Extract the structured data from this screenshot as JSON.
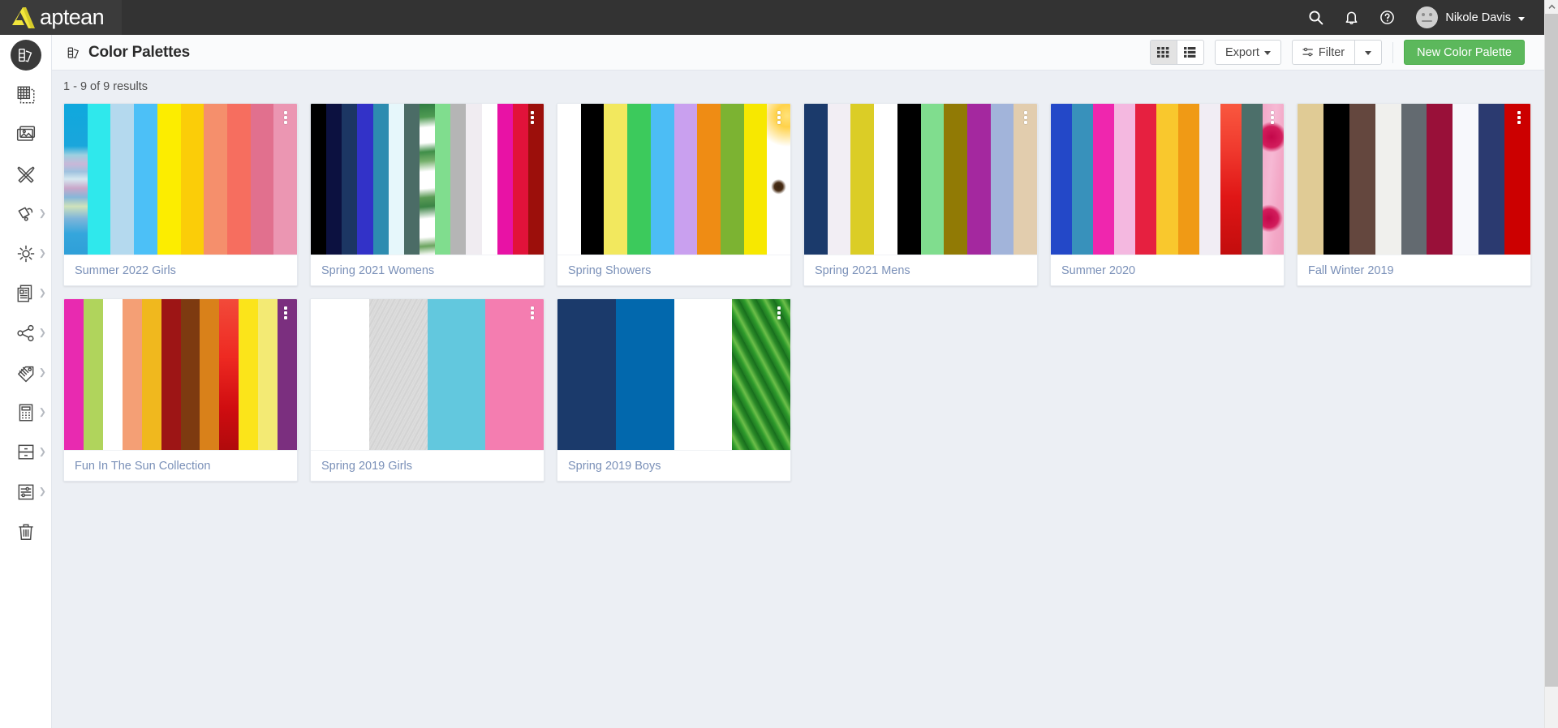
{
  "topbar": {
    "brand_name": "aptean",
    "brand_logo_icon": "aptean-triangle-logo",
    "icons": [
      {
        "name": "search-icon",
        "label": "Search"
      },
      {
        "name": "bell-icon",
        "label": "Notifications"
      },
      {
        "name": "help-icon",
        "label": "Help"
      }
    ],
    "user": {
      "name": "Nikole Davis",
      "avatar_icon": "user-avatar",
      "caret_icon": "chevron-down-icon"
    },
    "background_color": "#333333"
  },
  "sidebar": {
    "items": [
      {
        "name": "color-palettes",
        "icon": "color-palette-icon",
        "active": true,
        "has_arrow": false
      },
      {
        "name": "fabrics",
        "icon": "grid-sheets-icon",
        "active": false,
        "has_arrow": false
      },
      {
        "name": "images",
        "icon": "image-icon",
        "active": false,
        "has_arrow": false
      },
      {
        "name": "tools",
        "icon": "tools-cross-icon",
        "active": false,
        "has_arrow": false
      },
      {
        "name": "trims",
        "icon": "tag-pin-icon",
        "active": false,
        "has_arrow": true
      },
      {
        "name": "treatments",
        "icon": "sun-burst-icon",
        "active": false,
        "has_arrow": true
      },
      {
        "name": "documents",
        "icon": "documents-icon",
        "active": false,
        "has_arrow": true
      },
      {
        "name": "share",
        "icon": "share-nodes-icon",
        "active": false,
        "has_arrow": true
      },
      {
        "name": "labels",
        "icon": "label-tag-icon",
        "active": false,
        "has_arrow": true
      },
      {
        "name": "reports",
        "icon": "report-list-icon",
        "active": false,
        "has_arrow": true
      },
      {
        "name": "storage",
        "icon": "drawers-icon",
        "active": false,
        "has_arrow": true
      },
      {
        "name": "settings",
        "icon": "sliders-icon",
        "active": false,
        "has_arrow": true
      },
      {
        "name": "trash",
        "icon": "trash-icon",
        "active": false,
        "has_arrow": false
      }
    ]
  },
  "header": {
    "title": "Color Palettes",
    "title_icon": "color-palette-icon",
    "view_grid_label": "",
    "view_list_label": "",
    "view_grid_icon": "grid-view-icon",
    "view_list_icon": "list-view-icon",
    "active_view": "grid",
    "export_label": "Export",
    "filter_label": "Filter",
    "filter_icon": "filter-sliders-icon",
    "filter_dropdown_icon": "chevron-down-icon",
    "new_button_label": "New Color Palette",
    "new_button_color": "#5cb85c"
  },
  "main": {
    "results_text": "1 - 9 of 9 results",
    "card_menu_icon": "kebab-menu-icon",
    "palettes": [
      {
        "title": "Summer 2022 Girls",
        "swatches": [
          {
            "type": "texture",
            "class": "tex-beach"
          },
          {
            "type": "color",
            "hex": "#2fe8ec"
          },
          {
            "type": "color",
            "hex": "#b4d9ee"
          },
          {
            "type": "color",
            "hex": "#4cc0f7"
          },
          {
            "type": "color",
            "hex": "#fced00"
          },
          {
            "type": "color",
            "hex": "#fbcd08"
          },
          {
            "type": "color",
            "hex": "#f58f6c"
          },
          {
            "type": "color",
            "hex": "#f66e5f"
          },
          {
            "type": "color",
            "hex": "#e1708e"
          },
          {
            "type": "color",
            "hex": "#eb96b2"
          }
        ]
      },
      {
        "title": "Spring 2021 Womens",
        "swatches": [
          {
            "type": "color",
            "hex": "#000000"
          },
          {
            "type": "color",
            "hex": "#0c1140"
          },
          {
            "type": "color",
            "hex": "#1c3663"
          },
          {
            "type": "color",
            "hex": "#3232c8"
          },
          {
            "type": "color",
            "hex": "#2d8cb0"
          },
          {
            "type": "color",
            "hex": "#e6f7fb"
          },
          {
            "type": "color",
            "hex": "#4b6c66"
          },
          {
            "type": "texture",
            "class": "tex-leaf"
          },
          {
            "type": "color",
            "hex": "#80dd8e"
          },
          {
            "type": "color",
            "hex": "#b5b5b5"
          },
          {
            "type": "color",
            "hex": "#f0ecf1"
          },
          {
            "type": "color",
            "hex": "#ffffff"
          },
          {
            "type": "color",
            "hex": "#e812a5"
          },
          {
            "type": "color",
            "hex": "#e2123a"
          },
          {
            "type": "color",
            "hex": "#9c0f0b"
          }
        ]
      },
      {
        "title": "Spring Showers",
        "swatches": [
          {
            "type": "color",
            "hex": "#ffffff"
          },
          {
            "type": "color",
            "hex": "#000000"
          },
          {
            "type": "color",
            "hex": "#f2e85e"
          },
          {
            "type": "color",
            "hex": "#3cca5c"
          },
          {
            "type": "color",
            "hex": "#4cbdf5"
          },
          {
            "type": "color",
            "hex": "#c9a0ef"
          },
          {
            "type": "color",
            "hex": "#ef8c14"
          },
          {
            "type": "color",
            "hex": "#7cb332"
          },
          {
            "type": "color",
            "hex": "#f7e800"
          },
          {
            "type": "texture",
            "class": "tex-sunbug"
          }
        ]
      },
      {
        "title": "Spring 2021 Mens",
        "swatches": [
          {
            "type": "color",
            "hex": "#1b3a6b"
          },
          {
            "type": "color",
            "hex": "#f2eef4"
          },
          {
            "type": "color",
            "hex": "#dbcd26"
          },
          {
            "type": "color",
            "hex": "#ffffff"
          },
          {
            "type": "color",
            "hex": "#000000"
          },
          {
            "type": "color",
            "hex": "#80dd8e"
          },
          {
            "type": "color",
            "hex": "#917a05"
          },
          {
            "type": "color",
            "hex": "#a4289f"
          },
          {
            "type": "color",
            "hex": "#a2b4da"
          },
          {
            "type": "color",
            "hex": "#e2cdae"
          }
        ]
      },
      {
        "title": "Summer 2020",
        "swatches": [
          {
            "type": "color",
            "hex": "#2348c8"
          },
          {
            "type": "color",
            "hex": "#3891bb"
          },
          {
            "type": "color",
            "hex": "#ef26ae"
          },
          {
            "type": "color",
            "hex": "#f4b8e0"
          },
          {
            "type": "color",
            "hex": "#e62040"
          },
          {
            "type": "color",
            "hex": "#f9c82d"
          },
          {
            "type": "color",
            "hex": "#f09a15"
          },
          {
            "type": "color",
            "hex": "#f1edf4"
          },
          {
            "type": "texture",
            "class": "tex-redfade"
          },
          {
            "type": "color",
            "hex": "#4c6f6a"
          },
          {
            "type": "texture",
            "class": "tex-cherry"
          }
        ]
      },
      {
        "title": "Fall Winter 2019",
        "swatches": [
          {
            "type": "color",
            "hex": "#e0cb95"
          },
          {
            "type": "color",
            "hex": "#000000"
          },
          {
            "type": "color",
            "hex": "#64473e"
          },
          {
            "type": "color",
            "hex": "#f0f0ed"
          },
          {
            "type": "color",
            "hex": "#636a70"
          },
          {
            "type": "color",
            "hex": "#991039"
          },
          {
            "type": "color",
            "hex": "#f7f8fc"
          },
          {
            "type": "color",
            "hex": "#2b3a70"
          },
          {
            "type": "color",
            "hex": "#cc0000"
          }
        ]
      },
      {
        "title": "Fun In The Sun Collection",
        "swatches": [
          {
            "type": "color",
            "hex": "#e82ab0"
          },
          {
            "type": "color",
            "hex": "#b0d45c"
          },
          {
            "type": "color",
            "hex": "#ffffff"
          },
          {
            "type": "color",
            "hex": "#f49f75"
          },
          {
            "type": "color",
            "hex": "#f0b81e"
          },
          {
            "type": "color",
            "hex": "#9d1515"
          },
          {
            "type": "color",
            "hex": "#7d3a10"
          },
          {
            "type": "color",
            "hex": "#d9811a"
          },
          {
            "type": "texture",
            "class": "tex-redgrad"
          },
          {
            "type": "color",
            "hex": "#fbe41a"
          },
          {
            "type": "color",
            "hex": "#f3ea74"
          },
          {
            "type": "color",
            "hex": "#7b2f7f"
          }
        ]
      },
      {
        "title": "Spring 2019 Girls",
        "swatches": [
          {
            "type": "color",
            "hex": "#ffffff"
          },
          {
            "type": "texture",
            "class": "tex-concrete"
          },
          {
            "type": "color",
            "hex": "#62c8de"
          },
          {
            "type": "color",
            "hex": "#f47db0"
          }
        ]
      },
      {
        "title": "Spring 2019 Boys",
        "swatches": [
          {
            "type": "color",
            "hex": "#1b3a6b"
          },
          {
            "type": "color",
            "hex": "#0268ad"
          },
          {
            "type": "color",
            "hex": "#ffffff"
          },
          {
            "type": "texture",
            "class": "tex-grass"
          }
        ]
      }
    ]
  },
  "scrollbar": {
    "up_arrow_icon": "chevron-up-icon",
    "thumb_name": "scroll-thumb"
  }
}
